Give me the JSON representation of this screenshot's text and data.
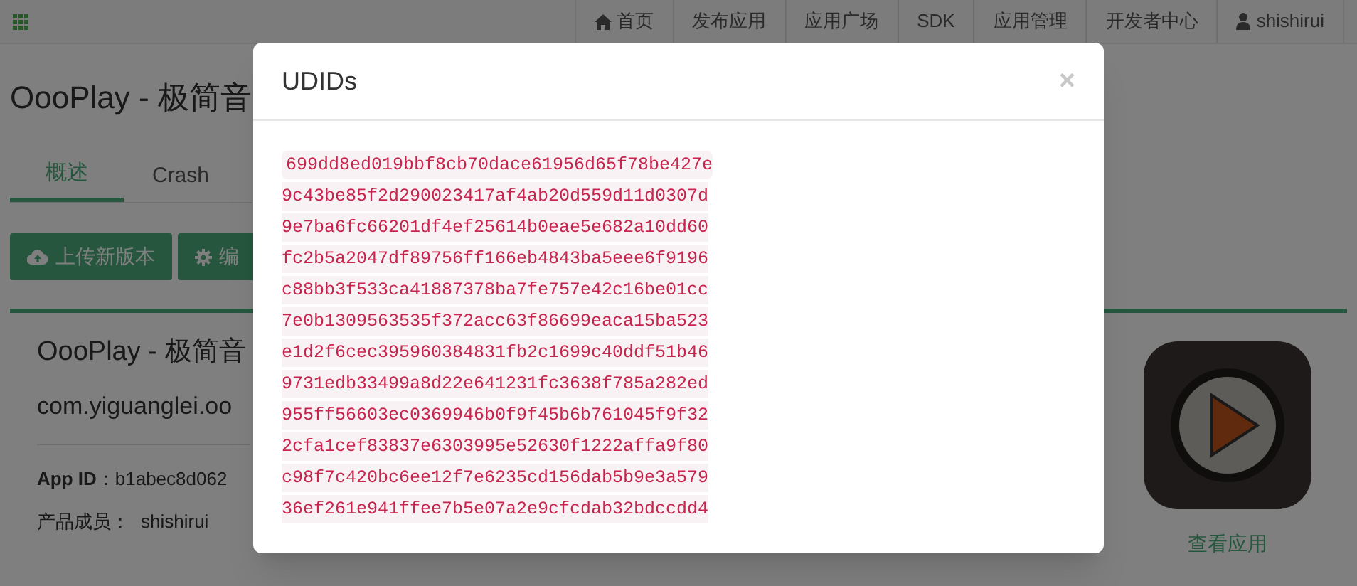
{
  "navbar": {
    "items": [
      {
        "label": "首页"
      },
      {
        "label": "发布应用"
      },
      {
        "label": "应用广场"
      },
      {
        "label": "SDK"
      },
      {
        "label": "应用管理"
      },
      {
        "label": "开发者中心"
      },
      {
        "label": "shishirui"
      }
    ]
  },
  "page_title": "OooPlay - 极简音",
  "tabs": [
    {
      "label": "概述",
      "selected": true
    },
    {
      "label": "Crash",
      "selected": false
    }
  ],
  "actions": [
    {
      "label": "上传新版本"
    },
    {
      "label": "编"
    }
  ],
  "app_panel": {
    "name": "OooPlay - 极简音",
    "bundle_id": "com.yiguanglei.oo",
    "fields": [
      {
        "label": "App ID",
        "value": "：b1abec8d062"
      },
      {
        "label": "产品成员：",
        "value": "shishirui"
      }
    ],
    "view_link": "查看应用"
  },
  "modal": {
    "title": "UDIDs",
    "close": "×",
    "udids": [
      "699dd8ed019bbf8cb70dace61956d65f78be427e",
      "9c43be85f2d290023417af4ab20d559d11d0307d",
      "9e7ba6fc66201df4ef25614b0eae5e682a10dd60",
      "fc2b5a2047df89756ff166eb4843ba5eee6f9196",
      "c88bb3f533ca41887378ba7fe757e42c16be01cc",
      "7e0b1309563535f372acc63f86699eaca15ba523",
      "e1d2f6cec395960384831fb2c1699c40ddf51b46",
      "9731edb33499a8d22e641231fc3638f785a282ed",
      "955ff56603ec0369946b0f9f45b6b761045f9f32",
      "2cfa1cef83837e6303995e52630f1222affa9f80",
      "c98f7c420bc6ee12f7e6235cd156dab5b9e3a579",
      "36ef261e941ffee7b5e07a2e9cfcdab32bdccdd4"
    ]
  }
}
